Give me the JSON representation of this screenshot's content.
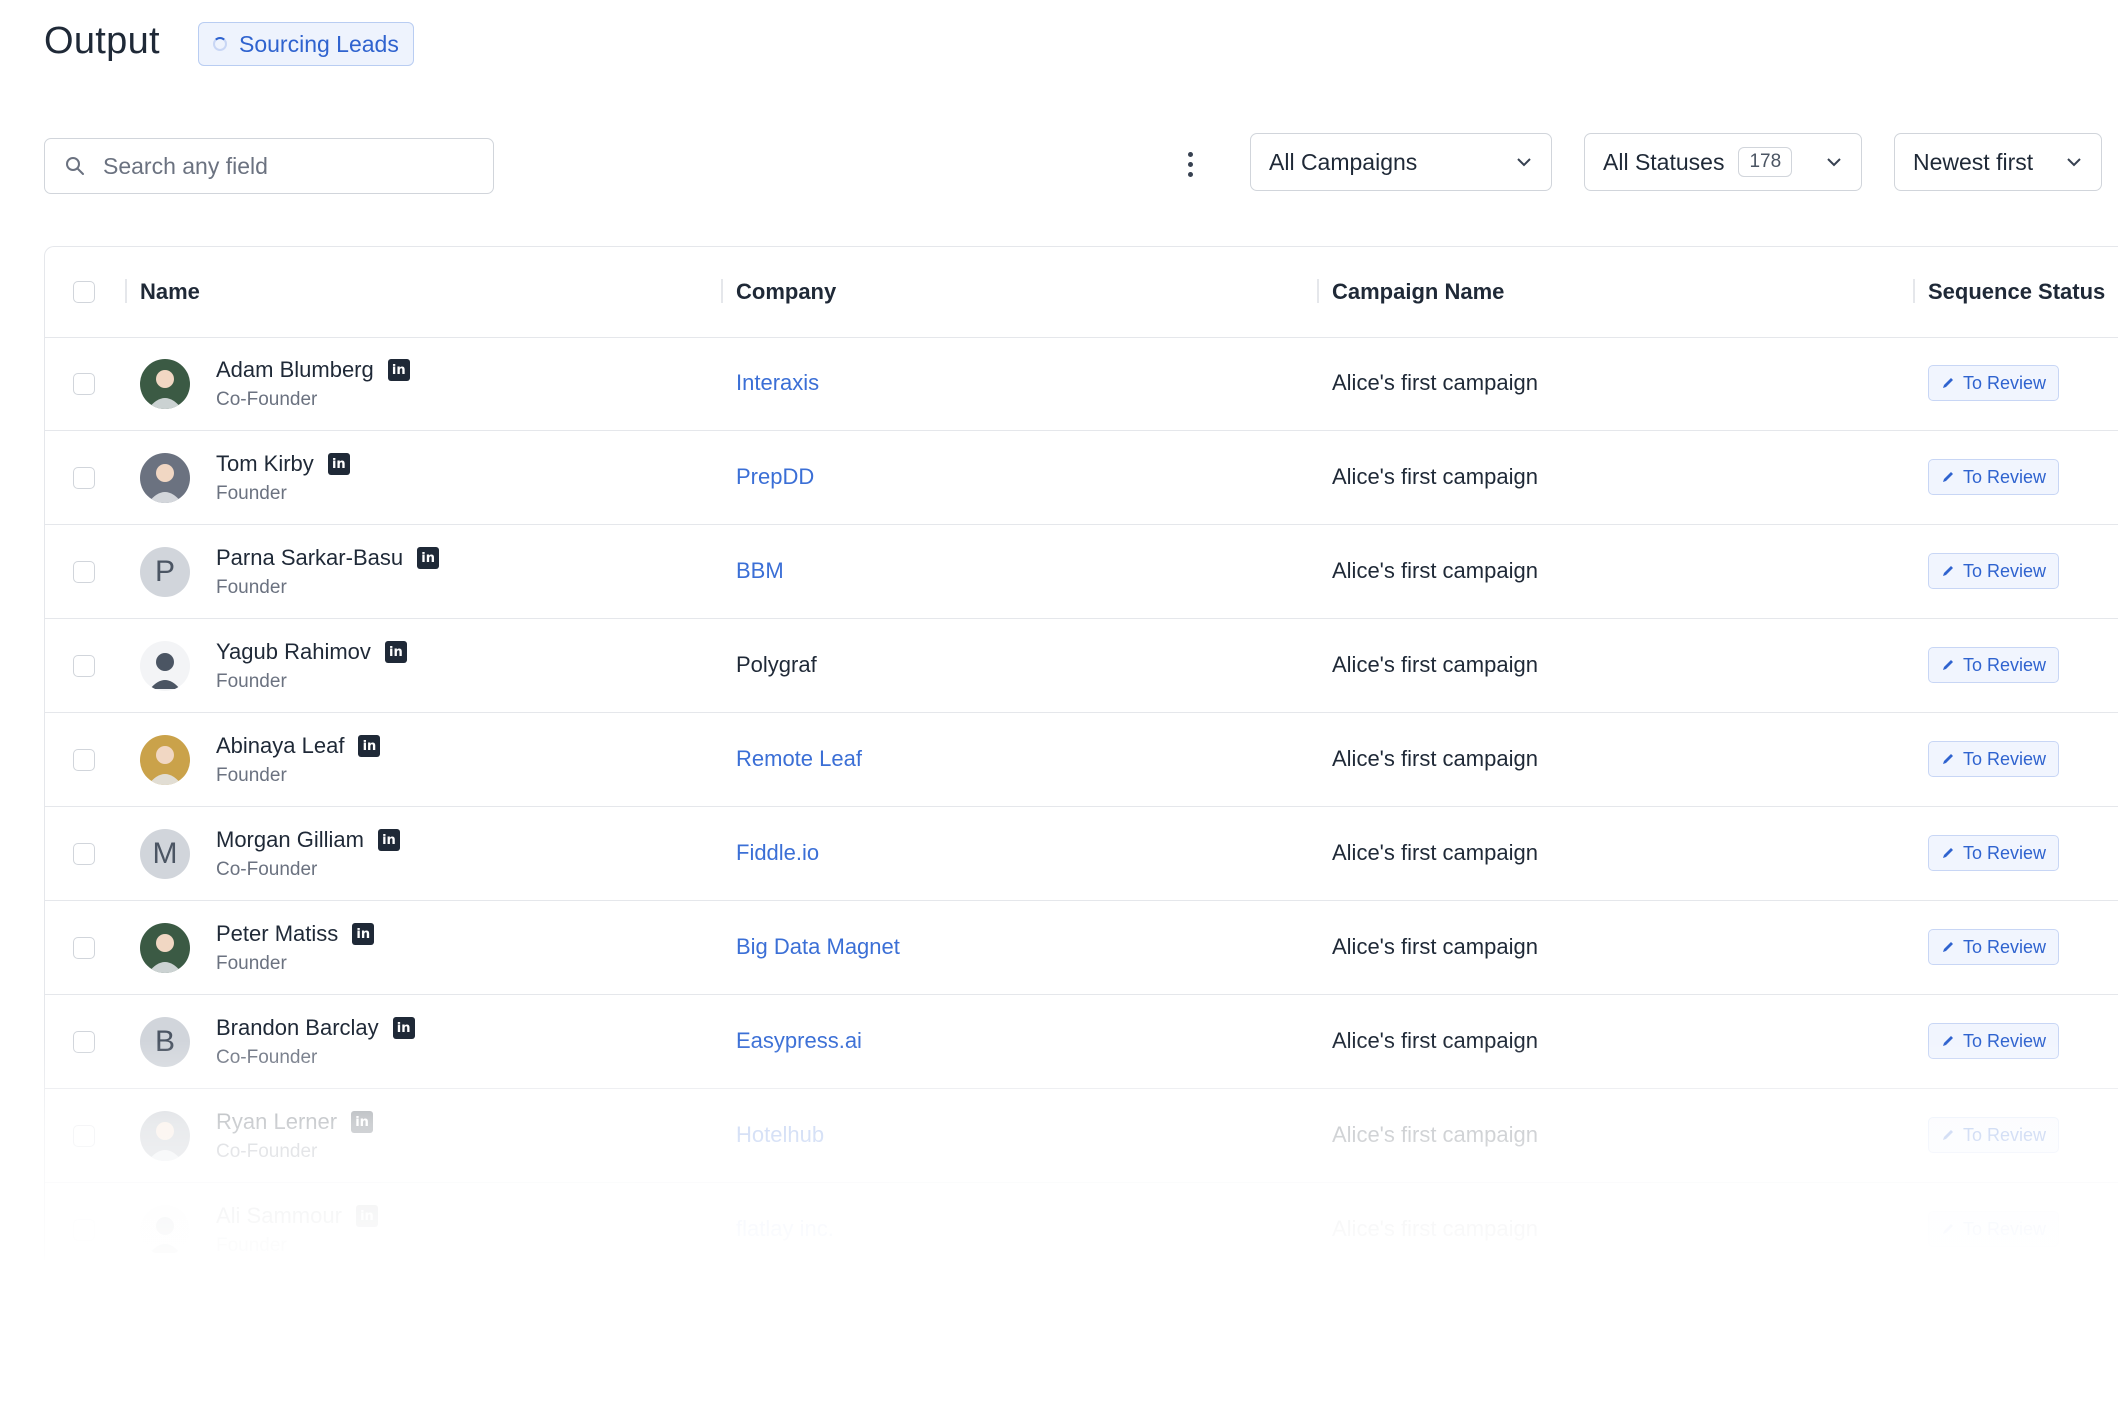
{
  "header": {
    "title": "Output",
    "status_pill": "Sourcing Leads"
  },
  "toolbar": {
    "search_placeholder": "Search any field",
    "campaign_filter": "All Campaigns",
    "status_filter": "All Statuses",
    "status_count": "178",
    "sort": "Newest first"
  },
  "table": {
    "columns": [
      "Name",
      "Company",
      "Campaign Name",
      "Sequence Status"
    ],
    "rows": [
      {
        "name": "Adam Blumberg",
        "title": "Co-Founder",
        "company": "Interaxis",
        "company_link": true,
        "campaign": "Alice's first campaign",
        "status": "To Review",
        "avatar": "photo"
      },
      {
        "name": "Tom Kirby",
        "title": "Founder",
        "company": "PrepDD",
        "company_link": true,
        "campaign": "Alice's first campaign",
        "status": "To Review",
        "avatar": "photo"
      },
      {
        "name": "Parna Sarkar-Basu",
        "title": "Founder",
        "company": "BBM",
        "company_link": true,
        "campaign": "Alice's first campaign",
        "status": "To Review",
        "avatar": "P"
      },
      {
        "name": "Yagub Rahimov",
        "title": "Founder",
        "company": "Polygraf",
        "company_link": false,
        "campaign": "Alice's first campaign",
        "status": "To Review",
        "avatar": "silhouette"
      },
      {
        "name": "Abinaya Leaf",
        "title": "Founder",
        "company": "Remote Leaf",
        "company_link": true,
        "campaign": "Alice's first campaign",
        "status": "To Review",
        "avatar": "photo"
      },
      {
        "name": "Morgan Gilliam",
        "title": "Co-Founder",
        "company": "Fiddle.io",
        "company_link": true,
        "campaign": "Alice's first campaign",
        "status": "To Review",
        "avatar": "M"
      },
      {
        "name": "Peter Matiss",
        "title": "Founder",
        "company": "Big Data Magnet",
        "company_link": true,
        "campaign": "Alice's first campaign",
        "status": "To Review",
        "avatar": "photo"
      },
      {
        "name": "Brandon Barclay",
        "title": "Co-Founder",
        "company": "Easypress.ai",
        "company_link": true,
        "campaign": "Alice's first campaign",
        "status": "To Review",
        "avatar": "B"
      },
      {
        "name": "Ryan Lerner",
        "title": "Co-Founder",
        "company": "Hotelhub",
        "company_link": true,
        "campaign": "Alice's first campaign",
        "status": "To Review",
        "avatar": "photo"
      },
      {
        "name": "Ali Sammour",
        "title": "Founder",
        "company": "flatlay inc.",
        "company_link": true,
        "campaign": "Alice's first campaign",
        "status": "To Review",
        "avatar": "silhouette"
      }
    ]
  },
  "colors": {
    "accent": "#2f63cf",
    "link": "#3b6fd6",
    "border": "#e5e7eb"
  },
  "icons": {
    "search": "search-icon",
    "more": "more-vertical-icon",
    "chevron": "chevron-down-icon",
    "linkedin": "linkedin-icon",
    "edit": "pencil-icon",
    "loading": "spinner-icon"
  }
}
